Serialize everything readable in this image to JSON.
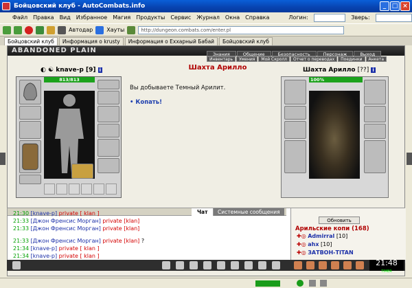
{
  "window": {
    "title": "Бойцовский клуб - AutoCombats.info"
  },
  "menu": [
    "Файл",
    "Правка",
    "Вид",
    "Избранное",
    "Магия",
    "Продукты",
    "Сервис",
    "Журнал",
    "Окна",
    "Справка"
  ],
  "login": {
    "login_label": "Логин:",
    "beast_label": "Зверь:"
  },
  "toolbar": {
    "autodar": "Автодар",
    "hauty": "Хауты",
    "address": "http://dungeon.combats.com/enter.pl"
  },
  "tabs": [
    "Бойцовский клуб",
    "Информация о krusty",
    "Информация о Еххарный Бабай",
    "Бойцовский клуб"
  ],
  "game": {
    "banner": "ABANDONED PLAIN",
    "nav_top": [
      "Знания",
      "Общение",
      "Безопасность",
      "Персонаж",
      "Выход"
    ],
    "nav_bottom": [
      "Инвентарь",
      "Умения",
      "Мой Скролл",
      "Отчет о переводах",
      "Поединки",
      "Анкета"
    ],
    "character": {
      "name": "knave-p",
      "level": "[9]",
      "hp": "813/813"
    },
    "location_title": "Шахта Арилло",
    "message": "Вы добываете Темный Арилит.",
    "dig_action": "Копать!",
    "mine": {
      "title": "Шахта Арилло",
      "level": "[??]",
      "hp": "100%"
    }
  },
  "chat": {
    "tab_chat": "Чат",
    "tab_system": "Системные сообщения",
    "lines": [
      {
        "time": "21:30",
        "name": "[knave-p]",
        "tag": "private [ klan ]"
      },
      {
        "time": "21:33",
        "name": "[Джон Френсис Морган]",
        "tag": "private [klan]"
      },
      {
        "time": "21:33",
        "name": "[Джон Френсис Морган]",
        "tag": "private [klan]"
      },
      {
        "time": "21:33",
        "name": "[Джон Френсис Морган]",
        "tag": "private [klan]",
        "extra": "?"
      },
      {
        "time": "21:34",
        "name": "[knave-p]",
        "tag": "private [ klan ]"
      },
      {
        "time": "21:34",
        "name": "[knave-p]",
        "tag": "private [ klan ]"
      }
    ],
    "refresh": "Обновить",
    "mine_online": "Арильские копи (168)",
    "players": [
      {
        "name": "Admirral",
        "level": "[10]"
      },
      {
        "name": "ahx",
        "level": "[10]"
      },
      {
        "name": "ЗАТВОН-TITAN",
        "level": ""
      }
    ]
  },
  "clock": {
    "time": "21:48",
    "label": "TIMER"
  },
  "colors": {
    "titlebar": "#0843b0",
    "hp_bar": "#1ca21c",
    "location_title": "#b00000",
    "chat_time": "#00a000"
  }
}
